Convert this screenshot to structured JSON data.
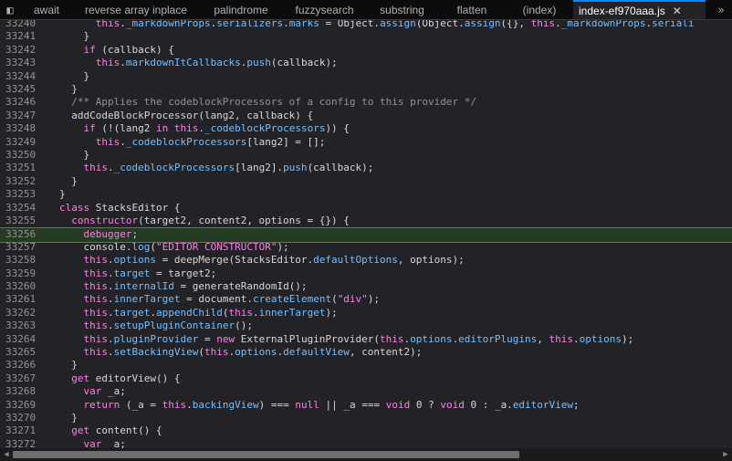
{
  "tabs": [
    {
      "label": "await"
    },
    {
      "label": "reverse array inplace"
    },
    {
      "label": "palindrome"
    },
    {
      "label": "fuzzysearch"
    },
    {
      "label": "substring"
    },
    {
      "label": "flatten"
    },
    {
      "label": "(index)"
    },
    {
      "label": "index-ef970aaa.js",
      "active": true
    }
  ],
  "tab_icons": {
    "sidebar_toggle": "sidebar-toggle-icon",
    "close": "close-icon",
    "overflow": "chevron-double-right-icon"
  },
  "close_glyph": "✕",
  "overflow_glyph": "»",
  "toggle_glyph": "◧",
  "paused_line": "33256",
  "lines": [
    {
      "n": "33240",
      "t": "        this._markdownProps.serializers.marks = Object.assign(Object.assign({}, this._markdownProps.seriali"
    },
    {
      "n": "33241",
      "t": "      }"
    },
    {
      "n": "33242",
      "t": "      if (callback) {"
    },
    {
      "n": "33243",
      "t": "        this.markdownItCallbacks.push(callback);"
    },
    {
      "n": "33244",
      "t": "      }"
    },
    {
      "n": "33245",
      "t": "    }"
    },
    {
      "n": "33246",
      "t": "    /** Applies the codeblockProcessors of a config to this provider */"
    },
    {
      "n": "33247",
      "t": "    addCodeBlockProcessor(lang2, callback) {"
    },
    {
      "n": "33248",
      "t": "      if (!(lang2 in this._codeblockProcessors)) {"
    },
    {
      "n": "33249",
      "t": "        this._codeblockProcessors[lang2] = [];"
    },
    {
      "n": "33250",
      "t": "      }"
    },
    {
      "n": "33251",
      "t": "      this._codeblockProcessors[lang2].push(callback);"
    },
    {
      "n": "33252",
      "t": "    }"
    },
    {
      "n": "33253",
      "t": "  }"
    },
    {
      "n": "33254",
      "t": "  class StacksEditor {"
    },
    {
      "n": "33255",
      "t": "    constructor(target2, content2, options = {}) {"
    },
    {
      "n": "33256",
      "t": "      debugger;"
    },
    {
      "n": "33257",
      "t": "      console.log(\"EDITOR CONSTRUCTOR\");"
    },
    {
      "n": "33258",
      "t": "      this.options = deepMerge(StacksEditor.defaultOptions, options);"
    },
    {
      "n": "33259",
      "t": "      this.target = target2;"
    },
    {
      "n": "33260",
      "t": "      this.internalId = generateRandomId();"
    },
    {
      "n": "33261",
      "t": "      this.innerTarget = document.createElement(\"div\");"
    },
    {
      "n": "33262",
      "t": "      this.target.appendChild(this.innerTarget);"
    },
    {
      "n": "33263",
      "t": "      this.setupPluginContainer();"
    },
    {
      "n": "33264",
      "t": "      this.pluginProvider = new ExternalPluginProvider(this.options.editorPlugins, this.options);"
    },
    {
      "n": "33265",
      "t": "      this.setBackingView(this.options.defaultView, content2);"
    },
    {
      "n": "33266",
      "t": "    }"
    },
    {
      "n": "33267",
      "t": "    get editorView() {"
    },
    {
      "n": "33268",
      "t": "      var _a;"
    },
    {
      "n": "33269",
      "t": "      return (_a = this.backingView) === null || _a === void 0 ? void 0 : _a.editorView;"
    },
    {
      "n": "33270",
      "t": "    }"
    },
    {
      "n": "33271",
      "t": "    get content() {"
    },
    {
      "n": "33272",
      "t": "      var _a;"
    }
  ],
  "scrollbar": {
    "left_arrow": "◀",
    "right_arrow": "▶"
  }
}
